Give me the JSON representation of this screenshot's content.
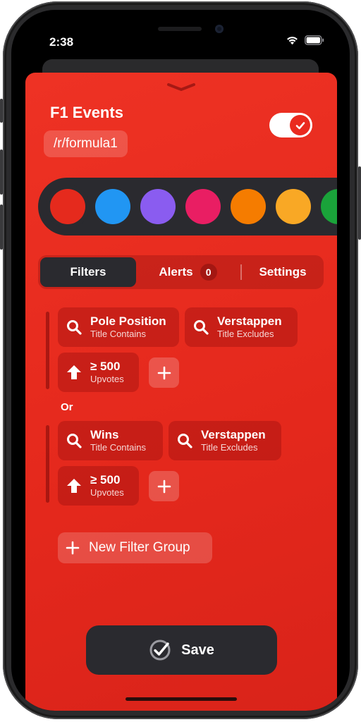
{
  "status_bar": {
    "time": "2:38"
  },
  "sheet": {
    "title": "F1 Events",
    "subreddit": "/r/formula1",
    "enabled": true
  },
  "colors": {
    "options": [
      {
        "name": "red",
        "hex": "#e52a1d",
        "selected": true
      },
      {
        "name": "blue",
        "hex": "#2196f3",
        "selected": false
      },
      {
        "name": "purple",
        "hex": "#8a5cf0",
        "selected": false
      },
      {
        "name": "pink",
        "hex": "#e91e63",
        "selected": false
      },
      {
        "name": "orange",
        "hex": "#f57c00",
        "selected": false
      },
      {
        "name": "amber",
        "hex": "#f9a825",
        "selected": false
      },
      {
        "name": "green",
        "hex": "#1aa33a",
        "selected": false
      }
    ]
  },
  "tabs": {
    "filters": "Filters",
    "alerts": "Alerts",
    "alerts_count": "0",
    "settings": "Settings",
    "active": "Filters"
  },
  "filter_groups": [
    {
      "filters": [
        {
          "value": "Pole Position",
          "type": "Title Contains",
          "icon": "search-icon"
        },
        {
          "value": "Verstappen",
          "type": "Title Excludes",
          "icon": "search-icon"
        },
        {
          "value": "≥ 500",
          "type": "Upvotes",
          "icon": "upvote-arrow-icon"
        }
      ]
    },
    {
      "filters": [
        {
          "value": "Wins",
          "type": "Title Contains",
          "icon": "search-icon"
        },
        {
          "value": "Verstappen",
          "type": "Title Excludes",
          "icon": "search-icon"
        },
        {
          "value": "≥ 500",
          "type": "Upvotes",
          "icon": "upvote-arrow-icon"
        }
      ]
    }
  ],
  "group_separator": "Or",
  "new_filter_group_label": "New Filter Group",
  "save_label": "Save",
  "accent": {
    "sheet_red": "#e62c1f",
    "dark": "#2a2a2f"
  }
}
